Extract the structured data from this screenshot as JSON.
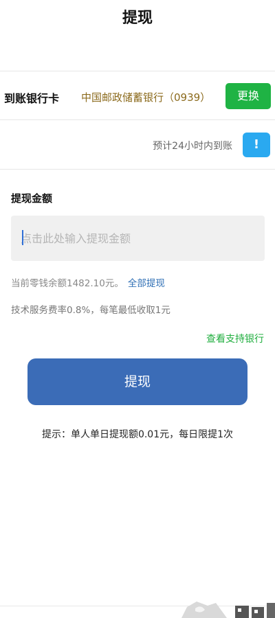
{
  "header": {
    "title": "提现"
  },
  "bank": {
    "label": "到账银行卡",
    "name": "中国邮政储蓄银行（0939）",
    "change_label": "更换"
  },
  "eta": {
    "text": "预计24小时内到账",
    "icon_glyph": "!"
  },
  "amount": {
    "title": "提现金额",
    "placeholder": "点击此处输入提现金额"
  },
  "balance": {
    "text": "当前零钱余额1482.10元。",
    "withdraw_all": "全部提现"
  },
  "fee": {
    "text": "技术服务费率0.8%，每笔最低收取1元"
  },
  "supported_banks_link": "查看支持银行",
  "submit": {
    "label": "提现"
  },
  "tip": {
    "text": "提示：单人单日提现额0.01元，每日限提1次"
  },
  "colors": {
    "change_button": "#1fb344",
    "info_button": "#2aa9f0",
    "submit_button": "#3b6cb7",
    "link_green": "#1fae3e",
    "link_blue": "#2f6fb5",
    "bank_name": "#8b6a1c"
  }
}
